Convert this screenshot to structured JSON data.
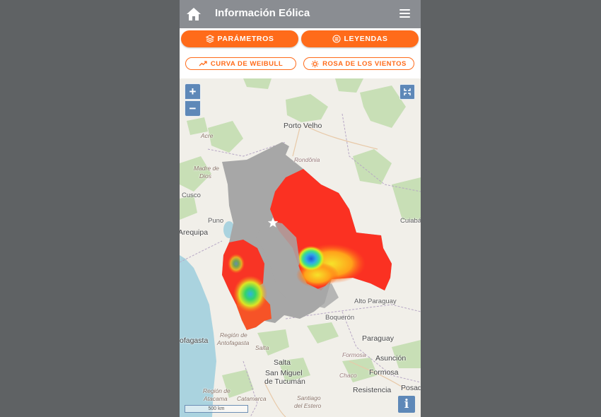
{
  "app": {
    "title": "Información Eólica"
  },
  "icons": {
    "home": "home-icon",
    "menu": "hamburger-menu-icon",
    "parametros": "layers-icon",
    "leyendas": "list-circle-icon",
    "weibull": "trending-up-icon",
    "rosa": "wind-rose-icon",
    "fullscreen": "fullscreen-icon",
    "info": "info-icon",
    "marker": "star-marker-icon"
  },
  "buttons": {
    "parametros": "PARÁMETROS",
    "leyendas": "LEYENDAS",
    "weibull": "CURVA DE WEIBULL",
    "rosa": "ROSA DE LOS VIENTOS"
  },
  "map": {
    "zoom_in": "+",
    "zoom_out": "−",
    "info": "i",
    "scale": "500 km",
    "labels": {
      "porto_velho": "Porto Velho",
      "acre": "Acre",
      "rondonia": "Rondônia",
      "madre_de_dios": "Madre de Dios",
      "cusco": "Cusco",
      "puno": "Puno",
      "arequipa": "Arequipa",
      "cuiaba": "Cuiabá",
      "alto_paraguay": "Alto Paraguay",
      "boqueron": "Boquerón",
      "paraguay": "Paraguay",
      "antofagasta_city": "ofagasta",
      "region_antofagasta_1": "Región de",
      "region_antofagasta_2": "Antofagasta",
      "salta_region": "Salta",
      "salta": "Salta",
      "formosa_region": "Formosa",
      "asuncion": "Asunción",
      "formosa": "Formosa",
      "san_miguel_1": "San Miguel",
      "san_miguel_2": "de Tucumán",
      "chaco": "Chaco",
      "resistencia": "Resistencia",
      "posadas": "Posad",
      "region_atacama_1": "Región de",
      "region_atacama_2": "Atacama",
      "catamarca": "Catamarca",
      "santiago_estero_1": "Santiago",
      "santiago_estero_2": "del Estero"
    }
  },
  "colors": {
    "header": "#8a8d92",
    "accent": "#ff6b1a",
    "map_control": "#5e88b8",
    "backdrop": "#5f6264"
  }
}
